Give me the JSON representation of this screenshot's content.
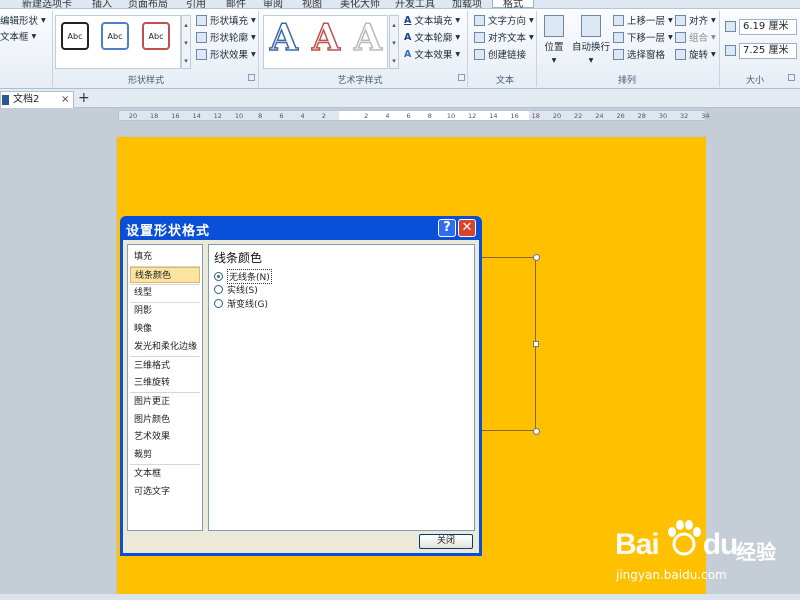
{
  "ribbon_tabs": [
    "新建选项卡",
    "插入",
    "页面布局",
    "引用",
    "邮件",
    "审阅",
    "视图",
    "美化大师",
    "开发工具",
    "加载项",
    "格式"
  ],
  "ribbon": {
    "edit_shape": "编辑形状",
    "text_box": "文本框",
    "style_samples": [
      "Abc",
      "Abc",
      "Abc"
    ],
    "shape_fill": "形状填充",
    "shape_outline": "形状轮廓",
    "shape_effect": "形状效果",
    "group_shape_styles": "形状样式",
    "wordart_samples": [
      "A",
      "A",
      "A"
    ],
    "text_fill": "文本填充",
    "text_outline": "文本轮廓",
    "text_effect": "文本效果",
    "group_wordart": "艺术字样式",
    "text_direction": "文字方向",
    "align_text": "对齐文本",
    "create_link": "创建链接",
    "group_text": "文本",
    "position": "位置",
    "wrap_text": "自动换行",
    "bring_forward": "上移一层",
    "send_backward": "下移一层",
    "selection_pane": "选择窗格",
    "align": "对齐",
    "group": "组合",
    "rotate": "旋转",
    "group_arrange": "排列",
    "height": "6.19 厘米",
    "width": "7.25 厘米",
    "group_size": "大小"
  },
  "doc_tab": {
    "name": "文档2",
    "close": "×",
    "add": "+"
  },
  "ruler_ticks": [
    "20",
    "18",
    "16",
    "14",
    "12",
    "10",
    "8",
    "6",
    "4",
    "2",
    "",
    "2",
    "4",
    "6",
    "8",
    "10",
    "12",
    "14",
    "16",
    "18",
    "20",
    "22",
    "24",
    "26",
    "28",
    "30",
    "32",
    "34"
  ],
  "dialog": {
    "title": "设置形状格式",
    "help": "?",
    "close": "✕",
    "categories": [
      "填充",
      "线条颜色",
      "线型",
      "阴影",
      "映像",
      "发光和柔化边缘",
      "三维格式",
      "三维旋转",
      "图片更正",
      "图片颜色",
      "艺术效果",
      "裁剪",
      "文本框",
      "可选文字"
    ],
    "selected_category": "线条颜色",
    "section_title": "线条颜色",
    "options": [
      {
        "label": "无线条",
        "key": "(N)",
        "selected": true
      },
      {
        "label": "实线",
        "key": "(S)",
        "selected": false
      },
      {
        "label": "渐变线",
        "key": "(G)",
        "selected": false
      }
    ],
    "close_button": "关闭"
  },
  "watermark": {
    "logo": "Bai",
    "logo2": "du",
    "jingyan": "经验",
    "url": "jingyan.baidu.com"
  },
  "colors": {
    "page": "#ffc000",
    "dialog_title": "#0a4fd8",
    "selected_item": "#fbe3a0"
  }
}
